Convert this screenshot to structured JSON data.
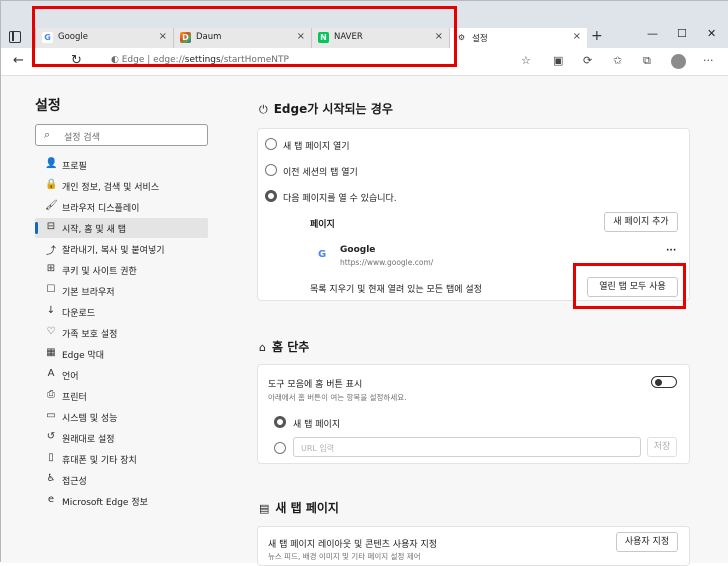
{
  "tabs": [
    {
      "title": "Google",
      "favicon": "google-favicon",
      "close": "×"
    },
    {
      "title": "Daum",
      "favicon": "daum-favicon",
      "close": "×"
    },
    {
      "title": "NAVER",
      "favicon": "naver-favicon",
      "close": "×"
    },
    {
      "title": "설정",
      "favicon": "gear-icon",
      "close": "×"
    }
  ],
  "tabstrip": {
    "new_tab": "+",
    "minimize": "—",
    "maximize": "☐",
    "close": "✕"
  },
  "address": {
    "site_label": "Edge",
    "url_prefix": "edge://",
    "url_bold": "settings",
    "url_rest": "/startHomeNTP"
  },
  "sidebar": {
    "title": "설정",
    "search_placeholder": "설정 검색",
    "items": [
      {
        "icon": "👤",
        "label": "프로필"
      },
      {
        "icon": "🔒",
        "label": "개인 정보, 검색 및 서비스"
      },
      {
        "icon": "🖌",
        "label": "브라우저 디스플레이"
      },
      {
        "icon": "⊟",
        "label": "시작, 홈 및 새 탭"
      },
      {
        "icon": "⤴",
        "label": "잘라내기, 복사 및 붙여넣기"
      },
      {
        "icon": "⊞",
        "label": "쿠키 및 사이트 권한"
      },
      {
        "icon": "☐",
        "label": "기본 브라우저"
      },
      {
        "icon": "↓",
        "label": "다운로드"
      },
      {
        "icon": "♡",
        "label": "가족 보호 설정"
      },
      {
        "icon": "▦",
        "label": "Edge 막대"
      },
      {
        "icon": "A",
        "label": "언어"
      },
      {
        "icon": "⎙",
        "label": "프린터"
      },
      {
        "icon": "▭",
        "label": "시스템 및 성능"
      },
      {
        "icon": "↺",
        "label": "원래대로 설정"
      },
      {
        "icon": "▯",
        "label": "휴대폰 및 기타 장치"
      },
      {
        "icon": "♿",
        "label": "접근성"
      },
      {
        "icon": "e",
        "label": "Microsoft Edge 정보"
      }
    ],
    "active_index": 3
  },
  "startup": {
    "title": "Edge가 시작되는 경우",
    "option1": "새 탭 페이지 열기",
    "option2": "이전 세션의 탭 열기",
    "option3": "다음 페이지를 열 수 있습니다.",
    "pages_label": "페이지",
    "add_page_button": "새 페이지 추가",
    "page_name": "Google",
    "page_url": "https://www.google.com/",
    "more": "···",
    "clear_text": "목록 지우기 및 현재 열려 있는 모든 탭에 설정",
    "use_open_tabs_button": "열린 탭 모두 사용"
  },
  "home": {
    "title": "홈 단추",
    "toggle_label": "도구 모음에 홈 버튼 표시",
    "toggle_desc": "아래에서 홈 버튼이 여는 항목을 설정하세요.",
    "option_ntp": "새 탭 페이지",
    "url_placeholder": "URL 입력",
    "save_button": "저장"
  },
  "newtab": {
    "title": "새 탭 페이지",
    "customize_label": "새 탭 페이지 레이아웃 및 콘텐츠 사용자 지정",
    "customize_desc": "뉴스 피드, 배경 이미지 및 기타 페이지 설정 제어",
    "customize_button": "사용자 지정"
  }
}
